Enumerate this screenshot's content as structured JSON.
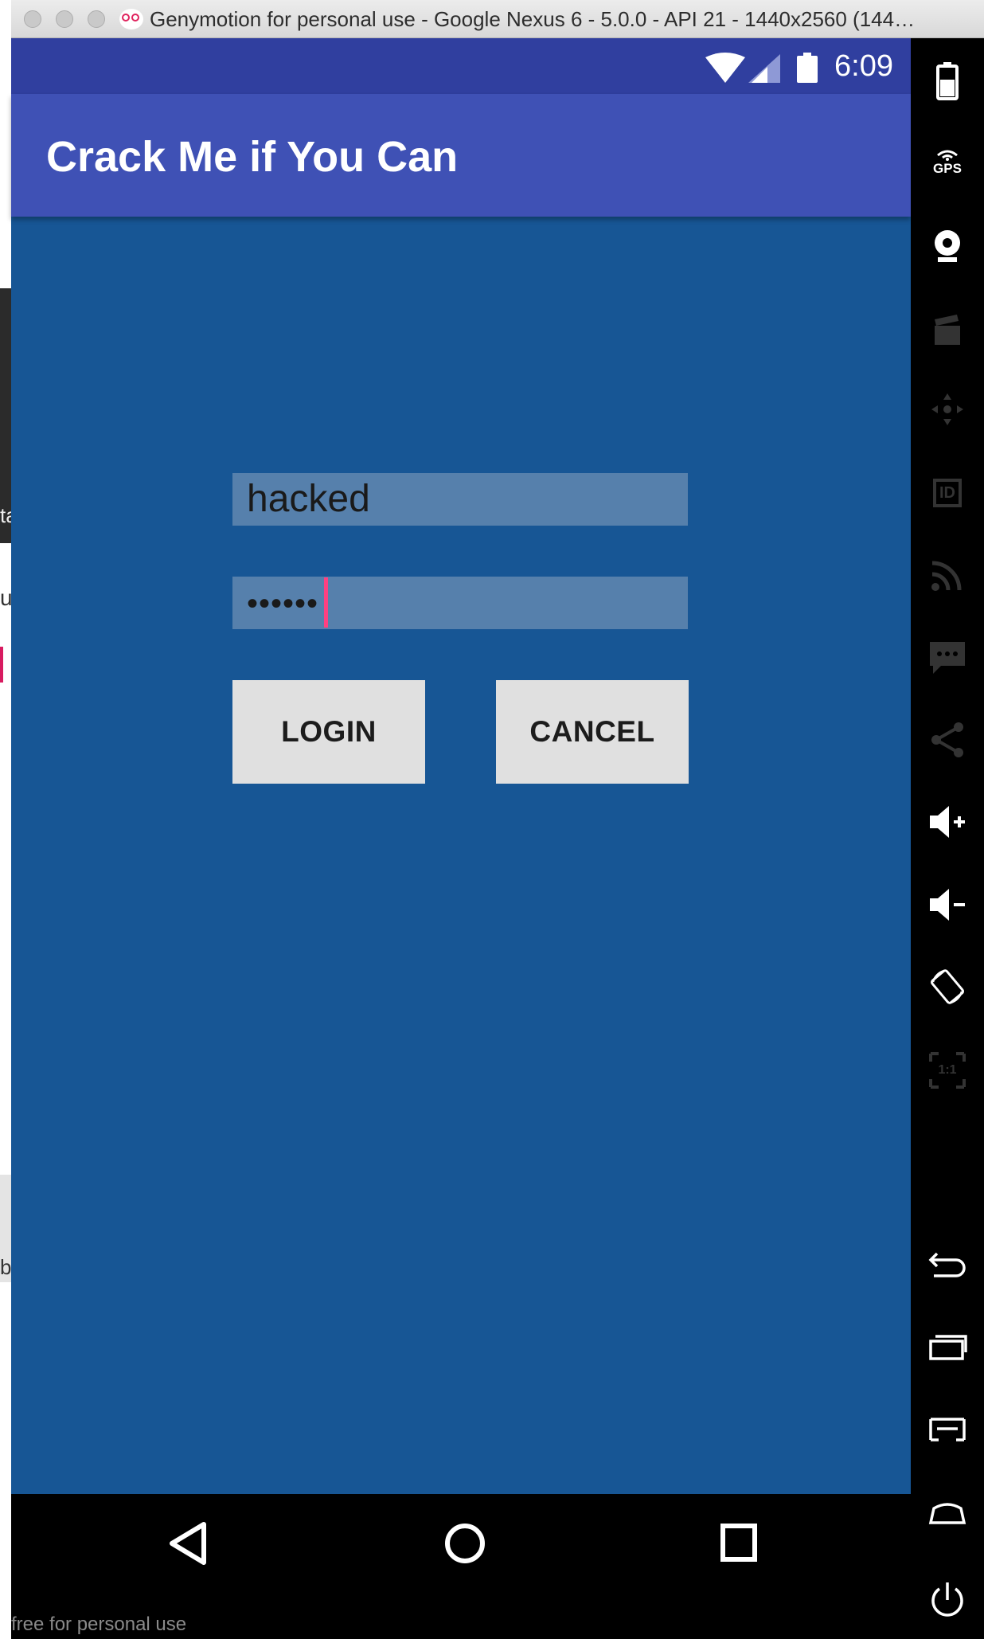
{
  "window": {
    "title": "Genymotion for personal use - Google Nexus 6 - 5.0.0 - API 21 - 1440x2560 (144…"
  },
  "status_bar": {
    "time": "6:09"
  },
  "app_bar": {
    "title": "Crack Me if You Can"
  },
  "login_form": {
    "username_value": "hacked",
    "password_masked": "••••••",
    "login_label": "LOGIN",
    "cancel_label": "CANCEL"
  },
  "sidebar": {
    "gps_label": "GPS",
    "id_label": "ID",
    "pixel_perfect_label": "1:1",
    "items": [
      "battery-icon",
      "gps-icon",
      "webcam-icon",
      "capture-icon",
      "remote-control-icon",
      "identifiers-icon",
      "network-icon",
      "sms-icon",
      "share-icon",
      "volume-up-icon",
      "volume-down-icon",
      "rotate-icon",
      "pixel-perfect-icon",
      "back-icon",
      "recent-apps-icon",
      "menu-icon",
      "home-icon",
      "power-icon"
    ]
  },
  "footer": {
    "watermark": "free for personal use"
  },
  "desktop_edge": {
    "chars": [
      "ta",
      "u",
      "b"
    ]
  },
  "colors": {
    "app_background": "#175695",
    "app_bar": "#3f51b5",
    "status_bar": "#303f9f",
    "input_field": "#5680ac",
    "button": "#e0e0e0",
    "caret": "#ff4081"
  }
}
